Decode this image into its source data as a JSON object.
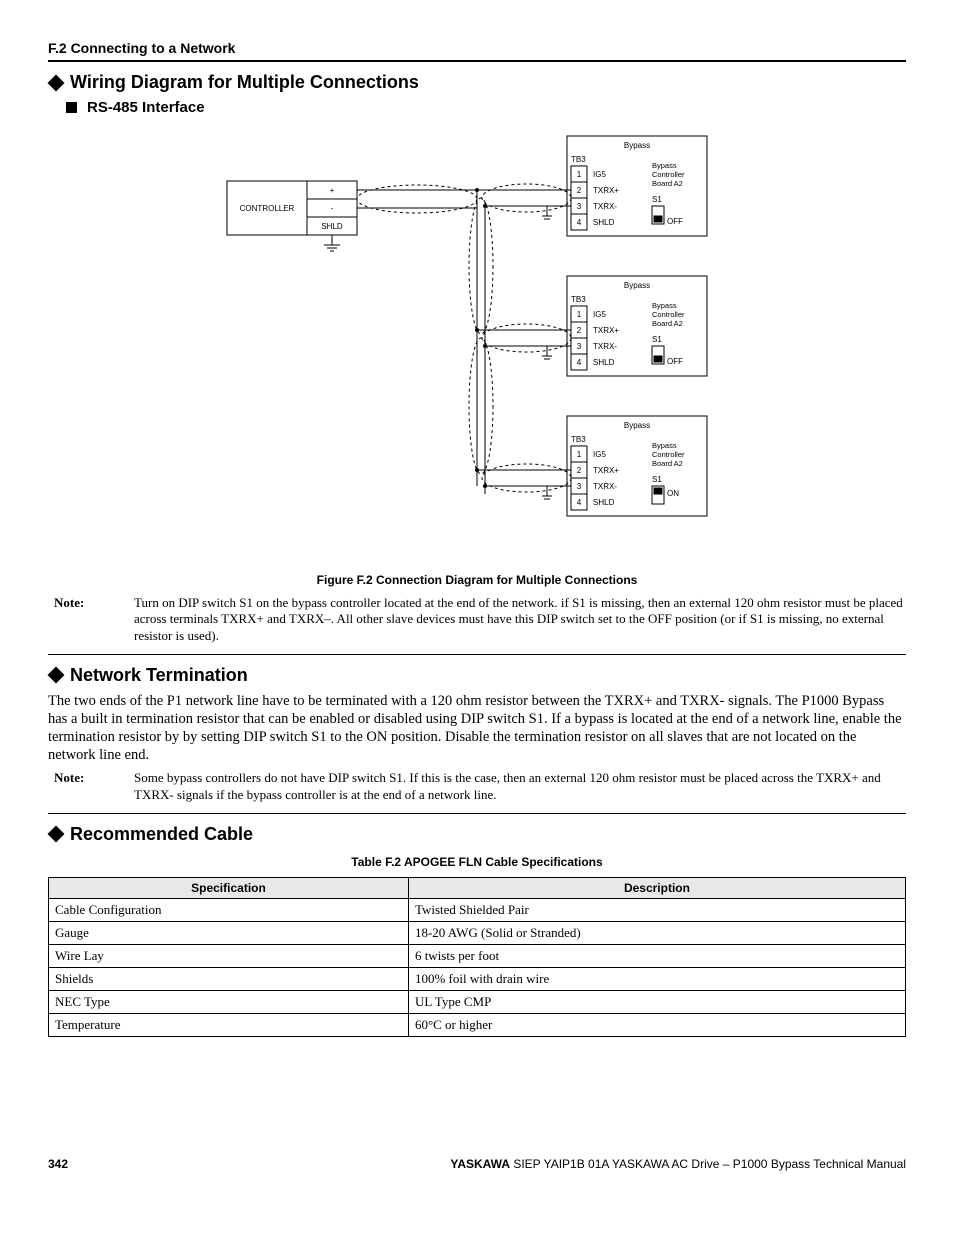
{
  "header": {
    "section": "F.2 Connecting to a Network"
  },
  "h1": "Wiring Diagram for Multiple Connections",
  "h2": "RS-485 Interface",
  "diagram": {
    "controller": "CONTROLLER",
    "plus": "+",
    "minus": "-",
    "shld": "SHLD",
    "bypass": "Bypass",
    "tb3": "TB3",
    "rows": [
      "1",
      "2",
      "3",
      "4"
    ],
    "sigs": [
      "IG5",
      "TXRX+",
      "TXRX-",
      "SHLD"
    ],
    "board": "Bypass Controller Board A2",
    "s1": "S1",
    "off": "OFF",
    "on": "ON"
  },
  "figcap": "Figure F.2  Connection Diagram for Multiple Connections",
  "note1": {
    "label": "Note:",
    "text": "Turn on DIP switch S1 on the bypass controller located at the end of the network. if S1 is missing, then an external 120 ohm resistor must be placed across terminals TXRX+ and TXRX–. All other slave devices must have this DIP switch set to the OFF position (or if S1 is missing, no external resistor is used)."
  },
  "h3": "Network Termination",
  "p1": "The two ends of the P1 network line have to be terminated with a 120 ohm resistor between the TXRX+ and TXRX- signals. The P1000 Bypass has a built in termination resistor that can be enabled or disabled using DIP switch S1. If a bypass is located at the end of a network line, enable the termination resistor by by setting DIP switch S1 to the ON position. Disable the termination resistor on all slaves that are not located on the network line end.",
  "note2": {
    "label": "Note:",
    "text": "Some bypass controllers do not have DIP switch S1. If this is the case, then an external 120 ohm resistor must be placed across the TXRX+ and TXRX- signals if the bypass controller is at the end of a network line."
  },
  "h4": "Recommended Cable",
  "tablecap": "Table F.2  APOGEE FLN Cable Specifications",
  "table": {
    "headers": [
      "Specification",
      "Description"
    ],
    "rows": [
      [
        "Cable Configuration",
        "Twisted Shielded Pair"
      ],
      [
        "Gauge",
        "18-20 AWG (Solid or Stranded)"
      ],
      [
        "Wire Lay",
        "6 twists per foot"
      ],
      [
        "Shields",
        "100% foil with drain wire"
      ],
      [
        "NEC Type",
        "UL Type CMP"
      ],
      [
        "Temperature",
        "60°C or higher"
      ]
    ]
  },
  "footer": {
    "page": "342",
    "brand": "YASKAWA",
    "text": " SIEP YAIP1B 01A YASKAWA AC Drive – P1000 Bypass Technical Manual"
  }
}
